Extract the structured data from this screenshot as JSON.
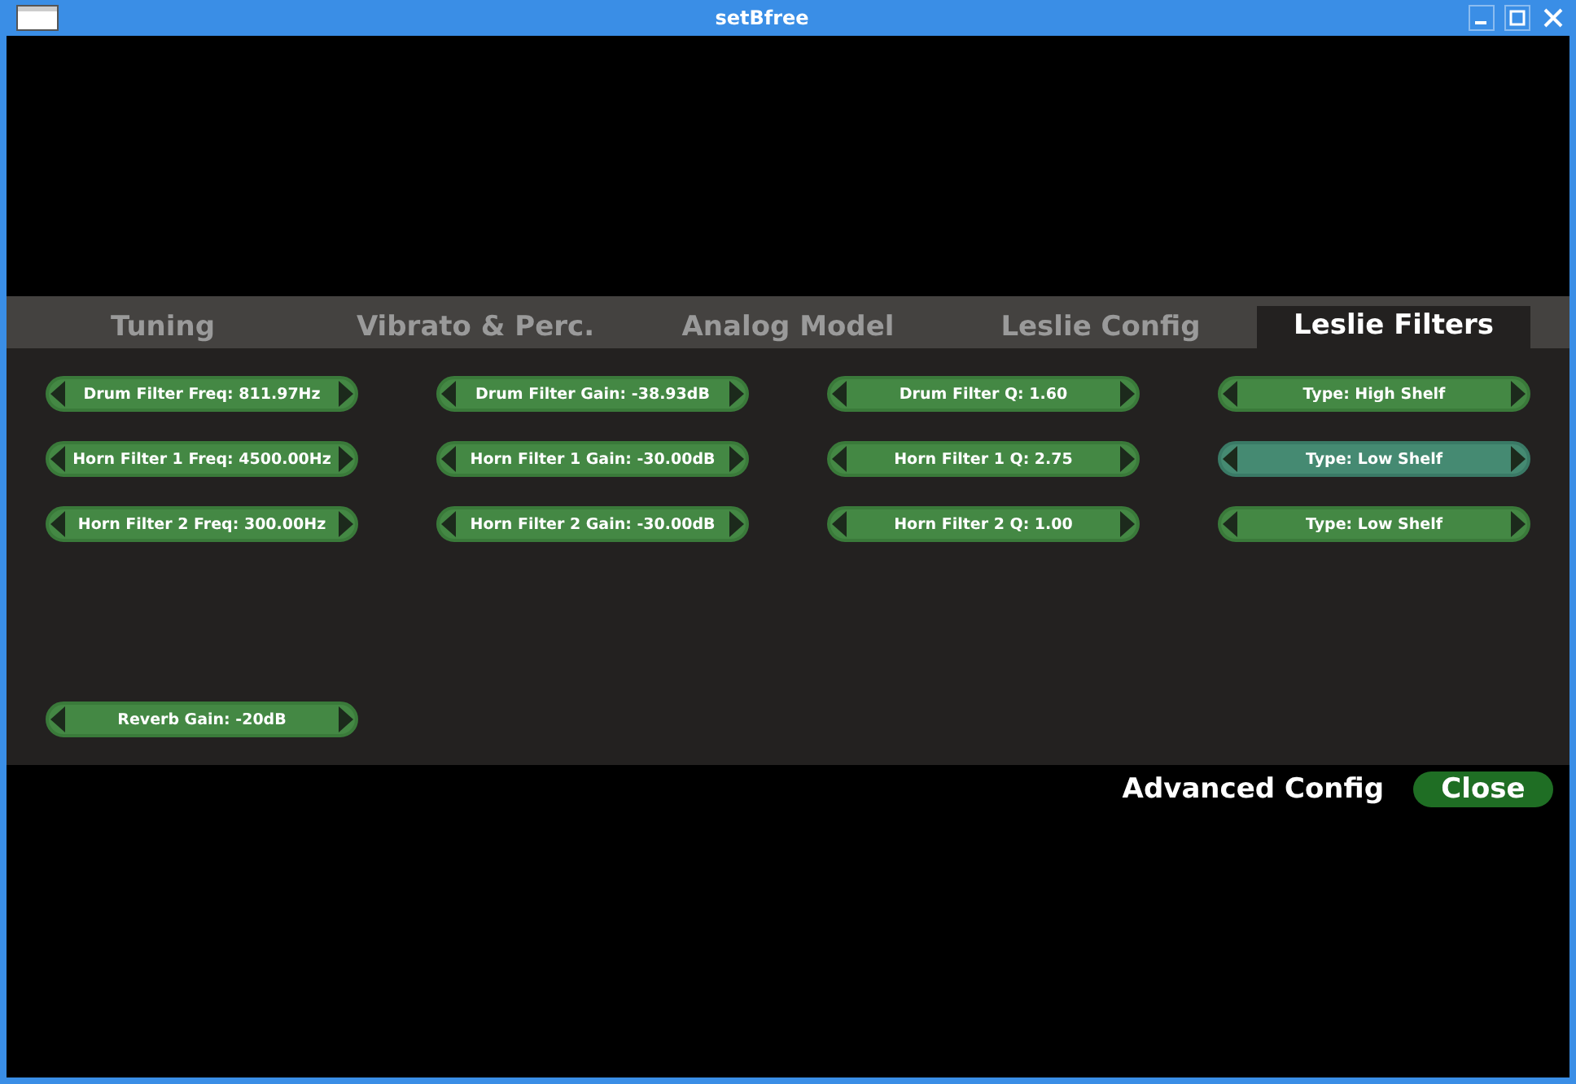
{
  "window": {
    "title": "setBfree"
  },
  "tabs": [
    {
      "label": "Tuning",
      "selected": false
    },
    {
      "label": "Vibrato & Perc.",
      "selected": false
    },
    {
      "label": "Analog Model",
      "selected": false
    },
    {
      "label": "Leslie Config",
      "selected": false
    },
    {
      "label": "Leslie Filters",
      "selected": true
    }
  ],
  "control_rows": [
    [
      {
        "label": "Drum Filter Freq: 811.97Hz",
        "highlighted": false
      },
      {
        "label": "Drum Filter Gain: -38.93dB",
        "highlighted": false
      },
      {
        "label": "Drum Filter Q: 1.60",
        "highlighted": false
      },
      {
        "label": "Type: High Shelf",
        "highlighted": false
      }
    ],
    [
      {
        "label": "Horn Filter 1 Freq: 4500.00Hz",
        "highlighted": false
      },
      {
        "label": "Horn Filter 1 Gain: -30.00dB",
        "highlighted": false
      },
      {
        "label": "Horn Filter 1 Q: 2.75",
        "highlighted": false
      },
      {
        "label": "Type: Low Shelf",
        "highlighted": true
      }
    ],
    [
      {
        "label": "Horn Filter 2 Freq: 300.00Hz",
        "highlighted": false
      },
      {
        "label": "Horn Filter 2 Gain: -30.00dB",
        "highlighted": false
      },
      {
        "label": "Horn Filter 2 Q: 1.00",
        "highlighted": false
      },
      {
        "label": "Type: Low Shelf",
        "highlighted": false
      }
    ]
  ],
  "reverb": {
    "label": "Reverb Gain: -20dB",
    "highlighted": false
  },
  "footer": {
    "advanced_config": "Advanced Config",
    "close": "Close"
  }
}
